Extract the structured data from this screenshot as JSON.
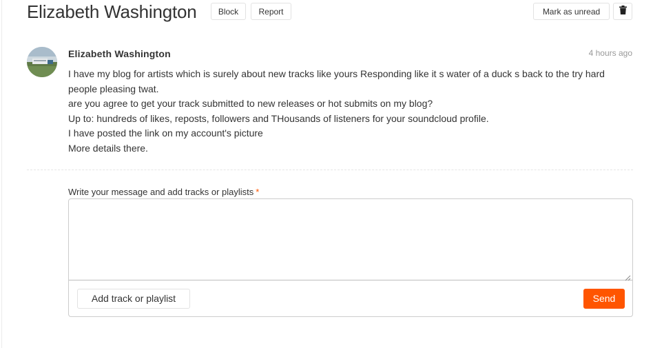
{
  "conversation": {
    "title": "Elizabeth Washington",
    "block_label": "Block",
    "report_label": "Report",
    "mark_unread_label": "Mark as unread",
    "delete_icon": "trash-icon"
  },
  "message": {
    "sender": "Elizabeth Washington",
    "timestamp": "4 hours ago",
    "lines": [
      "I have my blog for artists which is surely about new tracks like yours Responding like it s water of a duck s back to the try hard people pleasing twat.",
      "are you agree to get your track submitted to new releases or hot submits on my blog?",
      "Up to: hundreds of likes, reposts, followers and THousands of listeners for your soundcloud profile.",
      "I have posted the link on my account's picture",
      "More details there."
    ]
  },
  "reply": {
    "label": "Write your message and add tracks or playlists",
    "required_mark": "*",
    "value": "",
    "add_track_label": "Add track or playlist",
    "send_label": "Send"
  },
  "colors": {
    "accent": "#ff5500",
    "border": "#cccccc",
    "muted_text": "#999999"
  }
}
